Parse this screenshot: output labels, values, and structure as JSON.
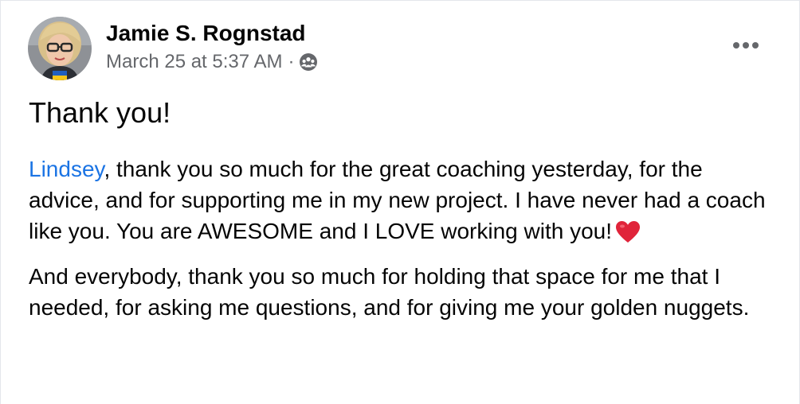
{
  "post": {
    "author": "Jamie S. Rognstad",
    "timestamp": "March 25 at 5:37 AM",
    "separator": "·",
    "audience_icon": "group-audience-icon",
    "more_icon": "more-horizontal-icon",
    "title": "Thank you!",
    "mention": "Lindsey",
    "paragraph1": ", thank you so much for the great coaching yesterday, for the advice, and for supporting me in my new project. I have never had a coach like you. You are AWESOME and I LOVE working with you!",
    "heart_icon": "red-heart-emoji",
    "paragraph2": "And everybody, thank you so much for holding that space for me that I needed, for asking me questions, and for giving me your golden nuggets."
  },
  "colors": {
    "mention": "#1b74e4",
    "secondary_text": "#65676b",
    "heart": "#e0243a"
  }
}
